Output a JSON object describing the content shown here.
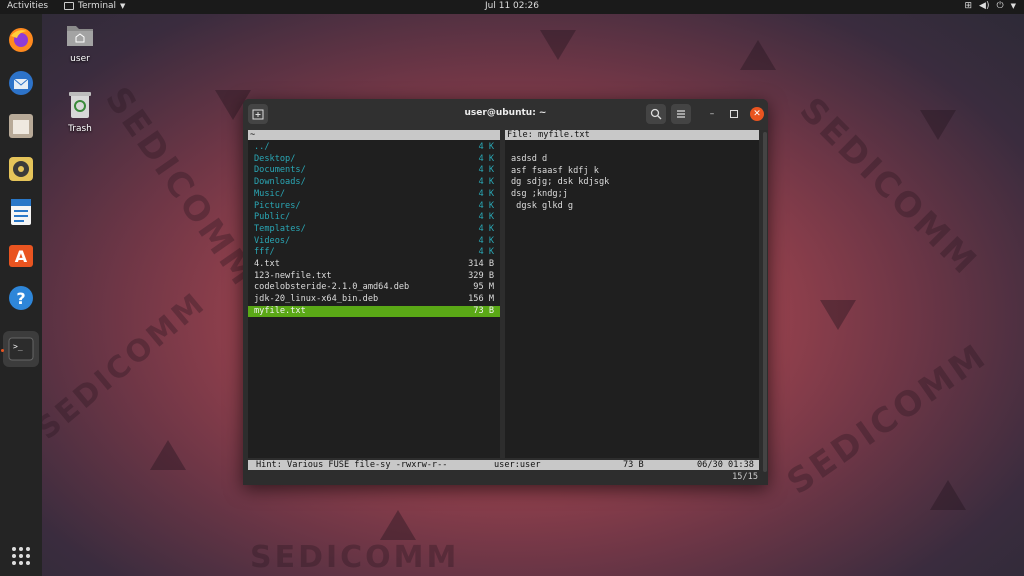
{
  "topbar": {
    "activities": "Activities",
    "app_name": "Terminal",
    "clock": "Jul 11  02:26"
  },
  "desktop": {
    "home_label": "user",
    "trash_label": "Trash"
  },
  "dock": [
    "firefox-icon",
    "thunderbird-icon",
    "files-icon",
    "rhythmbox-icon",
    "writer-icon",
    "software-icon",
    "help-icon",
    "terminal-icon"
  ],
  "window": {
    "title": "user@ubuntu: ~"
  },
  "left_panel": {
    "header": "~",
    "rows": [
      {
        "name": "../",
        "size": "4 K",
        "type": "dir"
      },
      {
        "name": "Desktop/",
        "size": "4 K",
        "type": "dir"
      },
      {
        "name": "Documents/",
        "size": "4 K",
        "type": "dir"
      },
      {
        "name": "Downloads/",
        "size": "4 K",
        "type": "dir"
      },
      {
        "name": "Music/",
        "size": "4 K",
        "type": "dir"
      },
      {
        "name": "Pictures/",
        "size": "4 K",
        "type": "dir"
      },
      {
        "name": "Public/",
        "size": "4 K",
        "type": "dir"
      },
      {
        "name": "Templates/",
        "size": "4 K",
        "type": "dir"
      },
      {
        "name": "Videos/",
        "size": "4 K",
        "type": "dir"
      },
      {
        "name": "fff/",
        "size": "4 K",
        "type": "dir"
      },
      {
        "name": "4.txt",
        "size": "314 B",
        "type": "file"
      },
      {
        "name": "123-newfile.txt",
        "size": "329 B",
        "type": "file"
      },
      {
        "name": "codelobsteride-2.1.0_amd64.deb",
        "size": "95 M",
        "type": "file"
      },
      {
        "name": "jdk-20_linux-x64_bin.deb",
        "size": "156 M",
        "type": "file"
      },
      {
        "name": "myfile.txt",
        "size": "73 B",
        "type": "selected"
      }
    ]
  },
  "right_panel": {
    "header": "File: myfile.txt",
    "lines": [
      "asdsd d",
      "asf fsaasf kdfj k",
      "dg sdjg; dsk kdjsgk",
      "dsg ;kndg;j",
      " dgsk glkd g"
    ]
  },
  "statusbar": {
    "hint": "Hint: Various FUSE file-sy -rwxrw-r--",
    "owner": "user:user",
    "size": "73 B",
    "date": "06/30 01:38"
  },
  "counter": "15/15"
}
